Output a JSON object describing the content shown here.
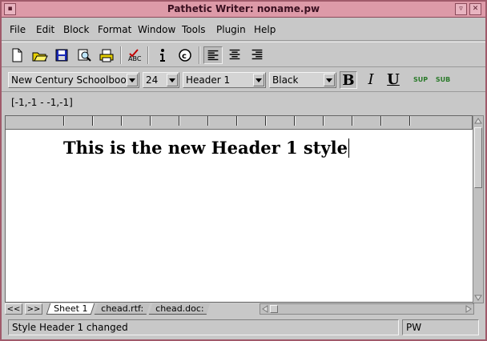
{
  "window": {
    "title": "Pathetic Writer: noname.pw",
    "controls": {
      "menu": "▪",
      "minimize": "▿",
      "close": "✕"
    }
  },
  "menu": [
    "File",
    "Edit",
    "Block",
    "Format",
    "Window",
    "Tools",
    "Plugin",
    "Help"
  ],
  "toolbar": {
    "buttons": [
      "new-file-icon",
      "open-folder-icon",
      "save-disk-icon",
      "preview-magnifier-icon",
      "print-icon",
      "spellcheck-icon",
      "info-icon",
      "copyright-icon",
      "align-left-icon",
      "align-center-icon",
      "align-right-icon"
    ],
    "active_alignment": "left"
  },
  "format_bar": {
    "font": "New Century Schoolbook",
    "size": "24",
    "style": "Header 1",
    "color": "Black",
    "bold_label": "B",
    "italic_label": "I",
    "underline_label": "U",
    "sup_label": "SUP",
    "sub_label": "SUB"
  },
  "cursor_position": "[-1,-1 - -1,-1]",
  "document": {
    "text": "This is the new Header 1 style"
  },
  "sheet_tabs": {
    "prev": "<<",
    "next": ">>",
    "tabs": [
      "Sheet 1",
      "chead.rtf:",
      "chead.doc:"
    ],
    "active": "Sheet 1"
  },
  "status": {
    "message": "Style Header 1 changed",
    "mode": "PW"
  }
}
